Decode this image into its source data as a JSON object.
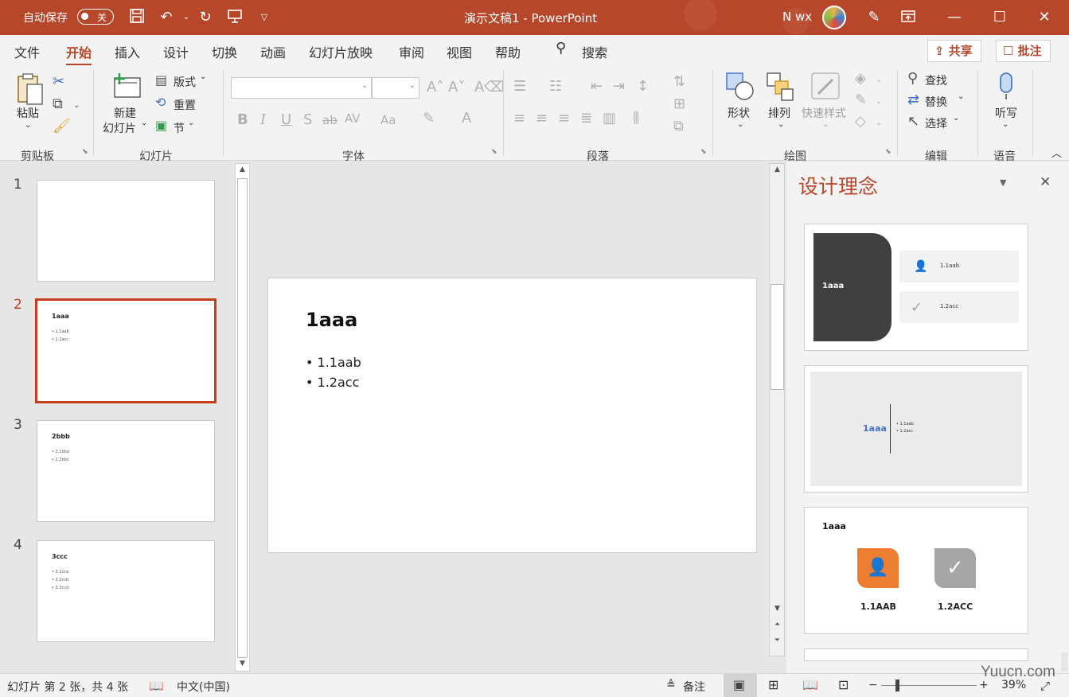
{
  "titlebar": {
    "autosave_label": "自动保存",
    "autosave_state": "关",
    "doc_title": "演示文稿1 - PowerPoint",
    "user": "N wx",
    "icons": [
      "save-icon",
      "undo-icon",
      "redo-icon",
      "present-icon",
      "customize-icon",
      "pen-icon",
      "ribbon-display-icon",
      "minimize-icon",
      "maximize-icon",
      "close-icon"
    ]
  },
  "menu": {
    "tabs": [
      "文件",
      "开始",
      "插入",
      "设计",
      "切换",
      "动画",
      "幻灯片放映",
      "审阅",
      "视图",
      "帮助"
    ],
    "active": "开始",
    "search": "搜索",
    "share": "共享",
    "comment": "批注"
  },
  "ribbon": {
    "clipboard": {
      "paste": "粘贴",
      "group": "剪贴板"
    },
    "slides": {
      "new_slide_1": "新建",
      "new_slide_2": "幻灯片",
      "layout": "版式",
      "reset": "重置",
      "section": "节",
      "group": "幻灯片"
    },
    "font": {
      "group": "字体",
      "bold": "B",
      "italic": "I",
      "underline": "U",
      "shadow": "S"
    },
    "paragraph": {
      "group": "段落"
    },
    "drawing": {
      "shapes": "形状",
      "arrange": "排列",
      "quick_styles": "快速样式",
      "group": "绘图"
    },
    "editing": {
      "find": "查找",
      "replace": "替换",
      "select": "选择",
      "group": "编辑"
    },
    "voice": {
      "dictate": "听写",
      "group": "语音"
    }
  },
  "slides": [
    {
      "num": "1",
      "title": "",
      "bullets": []
    },
    {
      "num": "2",
      "title": "1aaa",
      "bullets": [
        "• 1.1aab",
        "• 1.2acc"
      ],
      "selected": true
    },
    {
      "num": "3",
      "title": "2bbb",
      "bullets": [
        "• 2.1bba",
        "• 2.2bbc"
      ]
    },
    {
      "num": "4",
      "title": "3ccc",
      "bullets": [
        "• 3.1cca",
        "• 3.2ccb",
        "• 3.3ccd"
      ]
    }
  ],
  "current_slide": {
    "title": "1aaa",
    "bullets": [
      "• 1.1aab",
      "• 1.2acc"
    ]
  },
  "design_pane": {
    "title": "设计理念",
    "card1": {
      "title": "1aaa",
      "items": [
        "1.1aab",
        "1.2acc"
      ]
    },
    "card2": {
      "title": "1aaa",
      "items": [
        "• 1.1aab",
        "• 1.2acc"
      ]
    },
    "card3": {
      "title": "1aaa",
      "items": [
        "1.1AAB",
        "1.2ACC"
      ]
    }
  },
  "colors": {
    "accent": "#b7472a",
    "selected": "#c43e1c",
    "orange": "#ed7d31",
    "gray": "#a6a6a6",
    "dark": "#404040"
  },
  "status": {
    "slide_info": "幻灯片 第 2 张，共 4 张",
    "language": "中文(中国)",
    "notes": "备注",
    "zoom": "39%",
    "watermark": "Yuucn.com"
  }
}
